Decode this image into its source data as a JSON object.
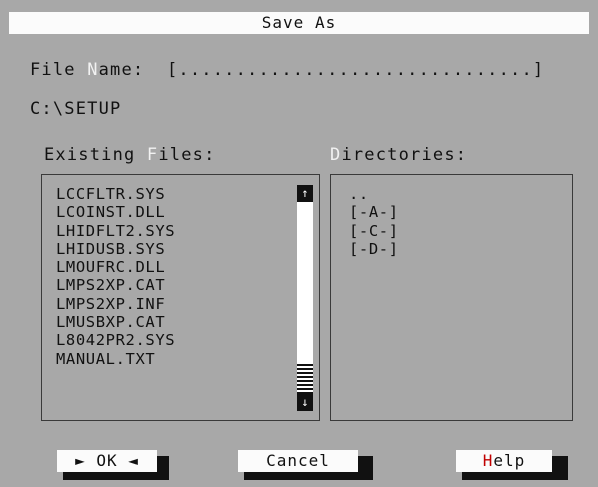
{
  "title": "Save As",
  "file_name": {
    "label_pre": "File ",
    "label_hot": "N",
    "label_post": "ame:",
    "field": "[...............................]"
  },
  "current_path": "C:\\SETUP",
  "existing_files": {
    "label_pre": "Existing ",
    "label_hot": "F",
    "label_post": "iles:",
    "items": [
      "LCCFLTR.SYS",
      "LCOINST.DLL",
      "LHIDFLT2.SYS",
      "LHIDUSB.SYS",
      "LMOUFRC.DLL",
      "LMPS2XP.CAT",
      "LMPS2XP.INF",
      "LMUSBXP.CAT",
      "L8042PR2.SYS",
      "MANUAL.TXT"
    ],
    "scroll_up_icon": "↑",
    "scroll_down_icon": "↓"
  },
  "directories": {
    "label_hot": "D",
    "label_post": "irectories:",
    "items": [
      "..",
      "[-A-]",
      "[-C-]",
      "[-D-]"
    ]
  },
  "buttons": {
    "ok": "► OK ◄",
    "cancel": "Cancel",
    "help_hot": "H",
    "help_rest": "elp"
  },
  "colors": {
    "dialog_bg": "#a8a8a8",
    "title_bg": "#fbfbfb",
    "hotkey_highlight": "#f2f2f2",
    "help_hotkey": "#c00000"
  }
}
